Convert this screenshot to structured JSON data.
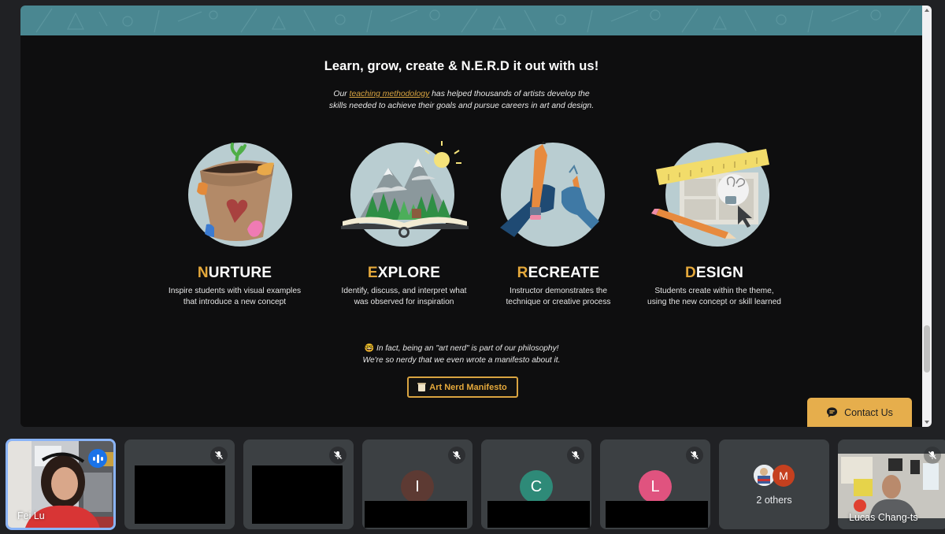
{
  "page": {
    "headline": "Learn, grow, create & N.E.R.D it out with us!",
    "intro": {
      "before_link": "Our ",
      "link_text": "teaching methodology",
      "after_link": " has helped thousands of artists develop the",
      "line2": "skills needed to achieve their goals and pursue careers in art and design."
    },
    "steps": [
      {
        "first_letter": "N",
        "rest": "URTURE",
        "line1": "Inspire students with visual examples",
        "line2": "that introduce a new concept",
        "illustration": "plant-pot-icon"
      },
      {
        "first_letter": "E",
        "rest": "XPLORE",
        "line1": "Identify, discuss, and interpret what",
        "line2": "was observed for inspiration",
        "illustration": "open-book-mountains-icon"
      },
      {
        "first_letter": "R",
        "rest": "ECREATE",
        "line1": "Instructor demonstrates the",
        "line2": "technique or creative process",
        "illustration": "hands-pencils-icon"
      },
      {
        "first_letter": "D",
        "rest": "ESIGN",
        "line1": "Students create within the theme,",
        "line2": "using the new concept or skill learned",
        "illustration": "ruler-pencil-lightbulb-icon"
      }
    ],
    "philosophy": {
      "emoji": "🤓",
      "line1": " In fact, being an \"art nerd\" is part of our philosophy!",
      "line2": "We're so nerdy that we even wrote a manifesto about it."
    },
    "manifesto_button": {
      "icon": "scroll-icon",
      "label": "Art Nerd Manifesto"
    },
    "contact_button": {
      "icon": "chat-icon",
      "label": "Contact Us"
    }
  },
  "colors": {
    "accent_gold": "#e4a83b",
    "banner_teal": "#4a8791",
    "speaking_blue": "#1a73e8",
    "active_border": "#8ab4f8"
  },
  "participants": [
    {
      "name": "Fei Lu",
      "type": "video",
      "speaking": true
    },
    {
      "name": "",
      "type": "hidden",
      "muted": true
    },
    {
      "name": "",
      "type": "hidden",
      "muted": true
    },
    {
      "initial": "I",
      "avatar_color": "#5d3a33",
      "muted": true
    },
    {
      "initial": "C",
      "avatar_color": "#2e8a78",
      "muted": true
    },
    {
      "initial": "L",
      "avatar_color": "#e0537f",
      "muted": true
    },
    {
      "label": "2 others",
      "second_initial": "M",
      "second_color": "#c5401f"
    },
    {
      "name": "Lucas Chang-ts",
      "type": "video",
      "muted": true
    }
  ]
}
